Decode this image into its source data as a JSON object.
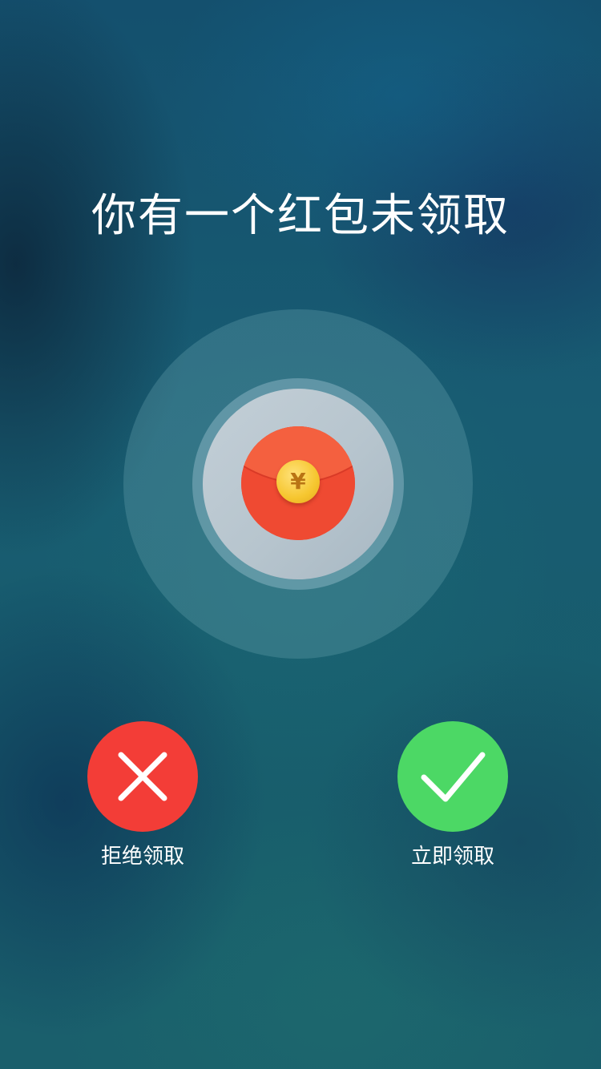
{
  "title": "你有一个红包未领取",
  "red_packet": {
    "icon": "red-envelope-icon",
    "coin_symbol": "¥",
    "envelope_color": "#ef4a32",
    "coin_color": "#f6c62f"
  },
  "actions": {
    "decline": {
      "label": "拒绝领取",
      "icon": "close-icon",
      "color": "#f33d37"
    },
    "accept": {
      "label": "立即领取",
      "icon": "check-icon",
      "color": "#4cd865"
    }
  }
}
